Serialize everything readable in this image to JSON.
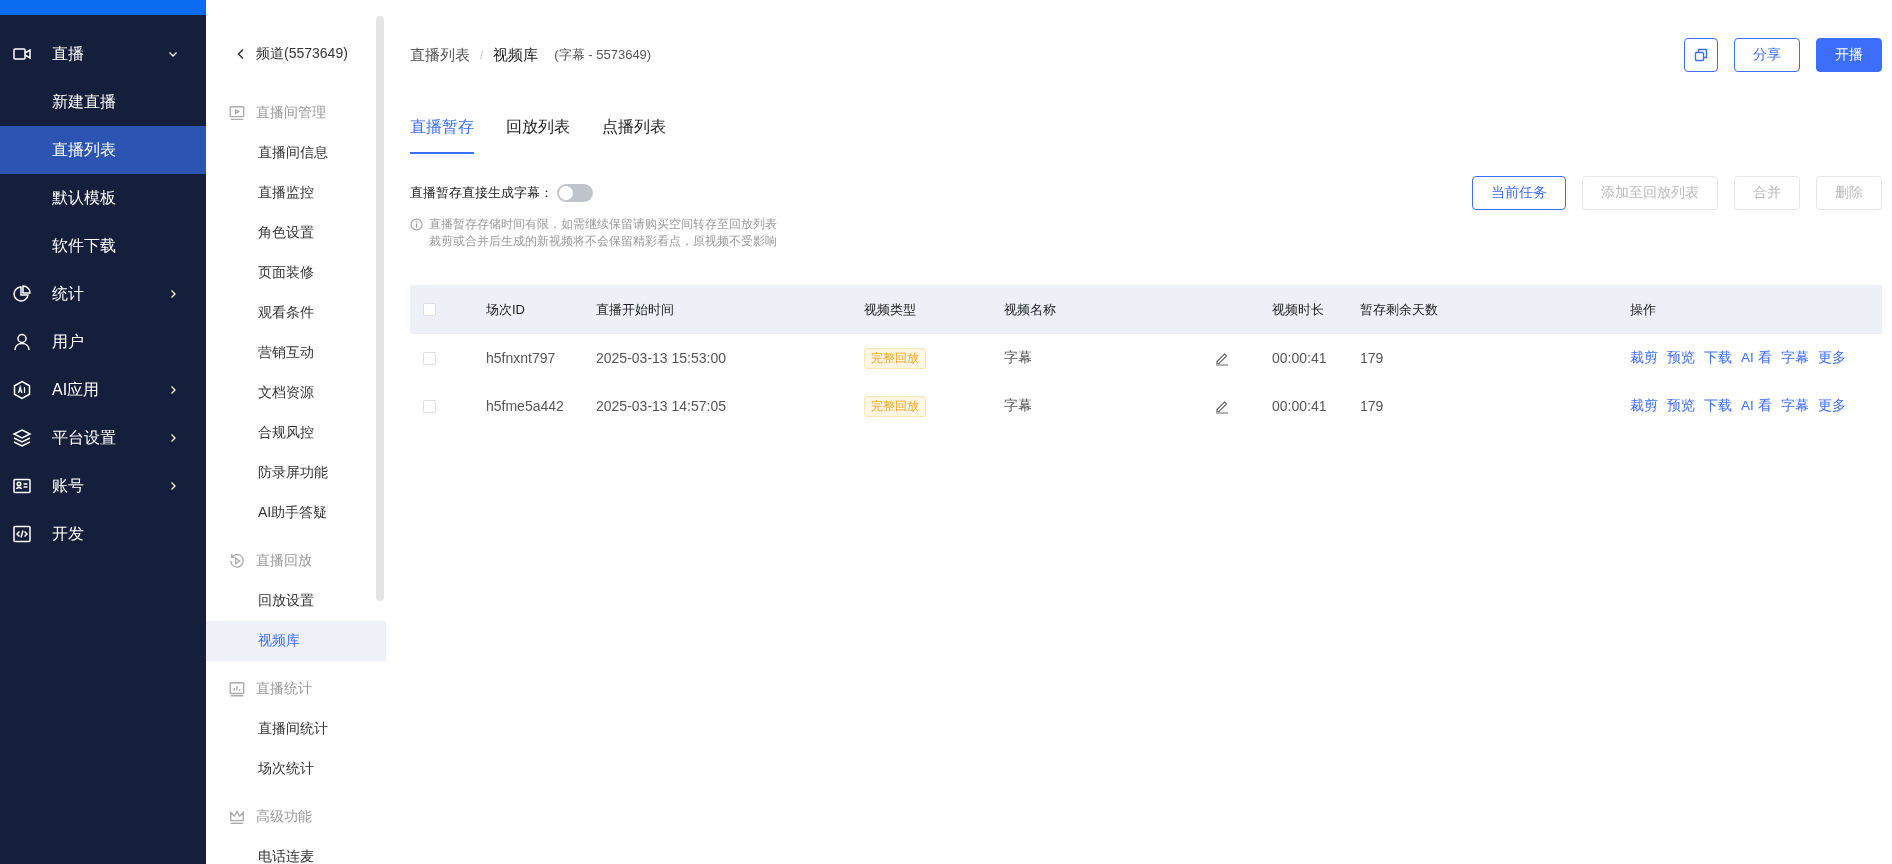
{
  "nav": {
    "items": [
      {
        "label": "直播",
        "selected": false,
        "expanded": true,
        "children": [
          {
            "label": "新建直播",
            "selected": false
          },
          {
            "label": "直播列表",
            "selected": true
          },
          {
            "label": "默认模板",
            "selected": false
          },
          {
            "label": "软件下载",
            "selected": false
          }
        ]
      },
      {
        "label": "统计",
        "selected": false,
        "expanded": false
      },
      {
        "label": "用户",
        "selected": false
      },
      {
        "label": "AI应用",
        "selected": false,
        "expanded": false
      },
      {
        "label": "平台设置",
        "selected": false,
        "expanded": false
      },
      {
        "label": "账号",
        "selected": false,
        "expanded": false
      },
      {
        "label": "开发",
        "selected": false
      }
    ]
  },
  "channel_menu": {
    "back": "频道(5573649)",
    "groups": [
      {
        "title": "直播间管理",
        "items": [
          {
            "label": "直播间信息",
            "selected": false
          },
          {
            "label": "直播监控",
            "selected": false
          },
          {
            "label": "角色设置",
            "selected": false
          },
          {
            "label": "页面装修",
            "selected": false
          },
          {
            "label": "观看条件",
            "selected": false
          },
          {
            "label": "营销互动",
            "selected": false
          },
          {
            "label": "文档资源",
            "selected": false
          },
          {
            "label": "合规风控",
            "selected": false
          },
          {
            "label": "防录屏功能",
            "selected": false
          },
          {
            "label": "AI助手答疑",
            "selected": false
          }
        ]
      },
      {
        "title": "直播回放",
        "items": [
          {
            "label": "回放设置",
            "selected": false
          },
          {
            "label": "视频库",
            "selected": true
          }
        ]
      },
      {
        "title": "直播统计",
        "items": [
          {
            "label": "直播间统计",
            "selected": false
          },
          {
            "label": "场次统计",
            "selected": false
          }
        ]
      },
      {
        "title": "高级功能",
        "items": [
          {
            "label": "电话连麦",
            "selected": false
          }
        ]
      }
    ]
  },
  "header": {
    "breadcrumb": [
      "直播列表",
      "/",
      "视频库"
    ],
    "subtitle": "(字幕 - 5573649)",
    "buttons": [
      {
        "kind": "icon"
      },
      {
        "kind": "outline",
        "label": "分享"
      },
      {
        "kind": "primary",
        "label": "开播"
      }
    ]
  },
  "tabs": [
    {
      "label": "直播暂存",
      "selected": true
    },
    {
      "label": "回放列表",
      "selected": false
    },
    {
      "label": "点播列表",
      "selected": false
    }
  ],
  "toggle": {
    "label": "直播暂存直接生成字幕：",
    "on": false
  },
  "actions": [
    {
      "label": "当前任务",
      "disabled": false
    },
    {
      "label": "添加至回放列表",
      "disabled": true
    },
    {
      "label": "合并",
      "disabled": true
    },
    {
      "label": "删除",
      "disabled": true
    }
  ],
  "notice": [
    "直播暂存存储时间有限，如需继续保留请购买空间转存至回放列表",
    "裁剪或合并后生成的新视频将不会保留精彩看点，原视频不受影响"
  ],
  "table": {
    "select_all": false,
    "columns": [
      "场次ID",
      "直播开始时间",
      "视频类型",
      "视频名称",
      "视频时长",
      "暂存剩余天数",
      "操作"
    ],
    "rows": [
      {
        "checked": false,
        "id": "h5fnxnt797",
        "start": "2025-03-13 15:53:00",
        "type": "完整回放",
        "name": "字幕",
        "duration": "00:00:41",
        "days": "179",
        "actions": [
          "裁剪",
          "预览",
          "下载",
          "AI 看",
          "字幕",
          "更多"
        ]
      },
      {
        "checked": false,
        "id": "h5fme5a442",
        "start": "2025-03-13 14:57:05",
        "type": "完整回放",
        "name": "字幕",
        "duration": "00:00:41",
        "days": "179",
        "actions": [
          "裁剪",
          "预览",
          "下载",
          "AI 看",
          "字幕",
          "更多"
        ]
      }
    ]
  }
}
